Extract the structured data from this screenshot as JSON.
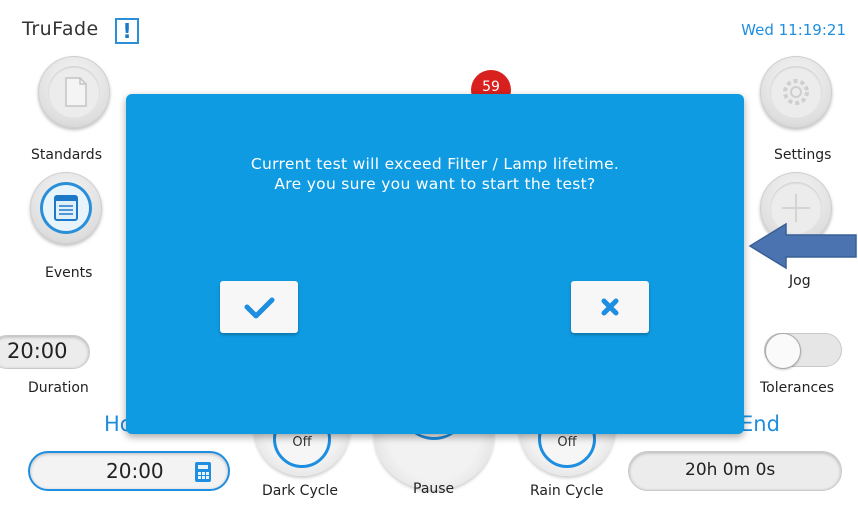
{
  "header": {
    "app_title": "TruFade",
    "alert_glyph": "!",
    "clock": "Wed 11:19:21"
  },
  "left_buttons": [
    {
      "label": "Standards",
      "icon": "document-icon"
    },
    {
      "label": "Events",
      "icon": "notepad-icon"
    }
  ],
  "right_buttons": [
    {
      "label": "Settings",
      "icon": "gear-icon"
    },
    {
      "label": "Jog",
      "icon": "move-arrows-icon"
    }
  ],
  "badge_count": "59",
  "duration": {
    "value": "20:00",
    "label": "Duration"
  },
  "tolerances": {
    "label": "Tolerances",
    "on": false
  },
  "bottom": {
    "left_partial_label": "Ho",
    "right_partial_label": "End",
    "time_input": "20:00",
    "end_time": "20h 0m 0s",
    "dark_cycle": {
      "state": "Off",
      "label": "Dark Cycle"
    },
    "pause": {
      "label": "Pause"
    },
    "rain_cycle": {
      "state": "Off",
      "label": "Rain Cycle"
    }
  },
  "dialog": {
    "line1": "Current test will exceed Filter / Lamp lifetime.",
    "line2": "Are you sure you want to start the test?",
    "confirm_icon": "checkmark-icon",
    "cancel_icon": "x-icon"
  },
  "colors": {
    "accent": "#0f9be2",
    "text_blue": "#1e8ee0",
    "badge": "#d8201e",
    "arrow": "#4a73b0"
  }
}
